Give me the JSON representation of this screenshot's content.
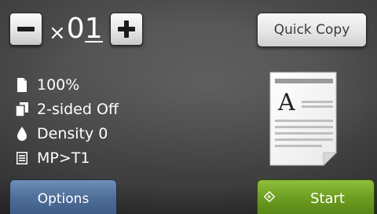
{
  "copies": {
    "times_symbol": "×",
    "leading_digit": "0",
    "cursor_digit": "1"
  },
  "buttons": {
    "minus_icon": "minus-icon",
    "plus_icon": "plus-icon",
    "quick_copy_label": "Quick Copy",
    "options_label": "Options",
    "start_label": "Start",
    "start_icon": "diamond-icon"
  },
  "settings": {
    "items": [
      {
        "icon": "page-size-icon",
        "label": "100%"
      },
      {
        "icon": "two-sided-icon",
        "label": "2-sided Off"
      },
      {
        "icon": "density-drop-icon",
        "label": "Density 0"
      },
      {
        "icon": "tray-icon",
        "label": "MP>T1"
      }
    ]
  },
  "preview": {
    "letter": "A"
  },
  "colors": {
    "options_button": "#4f6f99",
    "start_button": "#6e9f22",
    "background": "#4a4a4a"
  }
}
